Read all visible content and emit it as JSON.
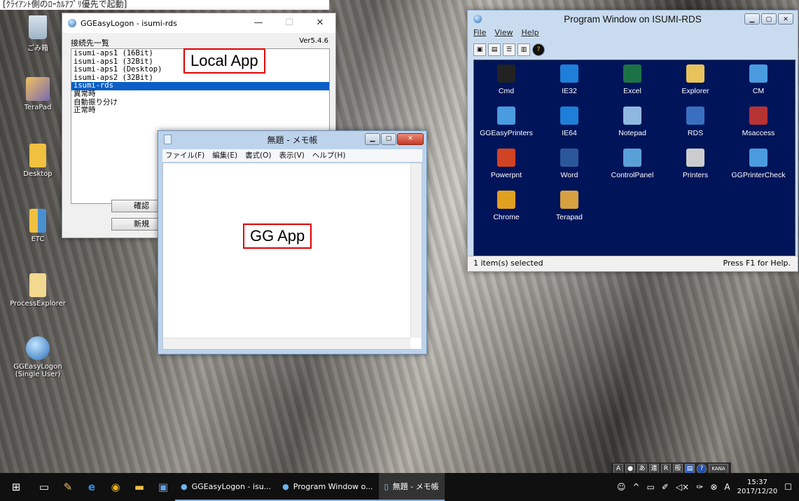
{
  "caption": "[ｸﾗｲｱﾝﾄ側のﾛｰｶﾙｱﾌﾟﾘ優先で起動]",
  "desktop_icons": [
    {
      "label": "ごみ箱",
      "icon": "recycle-bin-icon"
    },
    {
      "label": "TeraPad",
      "icon": "terapad-icon"
    },
    {
      "label": "Desktop",
      "icon": "folder-icon"
    },
    {
      "label": "ETC",
      "icon": "folder-icon"
    },
    {
      "label": "ProcessExplorer",
      "icon": "folder-icon"
    },
    {
      "label": "GGEasyLogon (Single User)",
      "icon": "globe-icon"
    }
  ],
  "gge_window": {
    "title": "GGEasyLogon - isumi-rds",
    "list_header": "接続先一覧",
    "version": "Ver5.4.6",
    "items": [
      "isumi-aps1 (16Bit)",
      "isumi-aps1 (32Bit)",
      "isumi-aps1 (Desktop)",
      "isumi-aps2 (32Bit)",
      "isumi-rds",
      "異常時",
      "自動振り分け",
      "正常時"
    ],
    "selected_index": 4,
    "confirm_label": "確認",
    "new_label": "新規"
  },
  "annotations": {
    "local": "Local App",
    "gg": "GG App"
  },
  "notepad": {
    "title": "無題 - メモ帳",
    "menu": [
      "ファイル(F)",
      "編集(E)",
      "書式(O)",
      "表示(V)",
      "ヘルプ(H)"
    ]
  },
  "program_window": {
    "title": "Program Window on ISUMI-RDS",
    "menu": [
      "File",
      "View",
      "Help"
    ],
    "apps": [
      {
        "label": "Cmd",
        "color": "#222222"
      },
      {
        "label": "IE32",
        "color": "#1e7fd8"
      },
      {
        "label": "Excel",
        "color": "#1d7245"
      },
      {
        "label": "Explorer",
        "color": "#e8c25a"
      },
      {
        "label": "CM",
        "color": "#4a9be0"
      },
      {
        "label": "GGEasyPrinters",
        "color": "#4a9be0"
      },
      {
        "label": "IE64",
        "color": "#1e7fd8"
      },
      {
        "label": "Notepad",
        "color": "#8fb8e0"
      },
      {
        "label": "RDS",
        "color": "#3a6fc0"
      },
      {
        "label": "Msaccess",
        "color": "#b73333"
      },
      {
        "label": "Powerpnt",
        "color": "#d04423"
      },
      {
        "label": "Word",
        "color": "#2b579a"
      },
      {
        "label": "ControlPanel",
        "color": "#5aa0d8"
      },
      {
        "label": "Printers",
        "color": "#cccccc"
      },
      {
        "label": "GGPrinterCheck",
        "color": "#4a9be0"
      },
      {
        "label": "Chrome",
        "color": "#e0a020"
      },
      {
        "label": "Terapad",
        "color": "#d8a040"
      }
    ],
    "status_left": "1 item(s) selected",
    "status_right": "Press F1 for Help."
  },
  "taskbar": {
    "tasks": [
      "GGEasyLogon - isu...",
      "Program Window o...",
      "無題 - メモ帳"
    ],
    "time": "15:37",
    "date": "2017/12/20",
    "ime_text": "KANA"
  }
}
